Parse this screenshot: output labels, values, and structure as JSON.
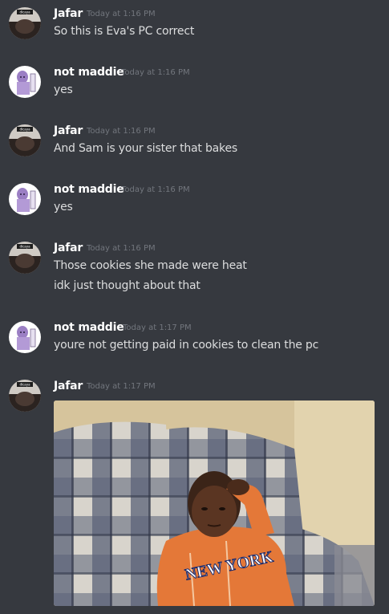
{
  "messages": [
    {
      "author": "Jafar",
      "timestamp": "Today at 1:16 PM",
      "lines": [
        "So this is Eva's PC correct"
      ]
    },
    {
      "author": "not maddie",
      "timestamp": "Today at 1:16 PM",
      "lines": [
        "yes"
      ]
    },
    {
      "author": "Jafar",
      "timestamp": "Today at 1:16 PM",
      "lines": [
        "And Sam is your sister that bakes"
      ]
    },
    {
      "author": "not maddie",
      "timestamp": "Today at 1:16 PM",
      "lines": [
        "yes"
      ]
    },
    {
      "author": "Jafar",
      "timestamp": "Today at 1:16 PM",
      "lines": [
        "Those cookies she made were heat",
        "idk just thought about that"
      ]
    },
    {
      "author": "not maddie",
      "timestamp": "Today at 1:17 PM",
      "lines": [
        "youre not getting paid in cookies to clean the pc"
      ]
    },
    {
      "author": "Jafar",
      "timestamp": "Today at 1:17 PM",
      "lines": []
    }
  ],
  "avatars": {
    "jafar_badge_text": "dicaya"
  },
  "gif": {
    "jersey_text": "NEW YORK"
  },
  "colors": {
    "background": "#36393f",
    "author": "#ffffff",
    "text": "#dcddde",
    "timestamp": "#72767d"
  }
}
